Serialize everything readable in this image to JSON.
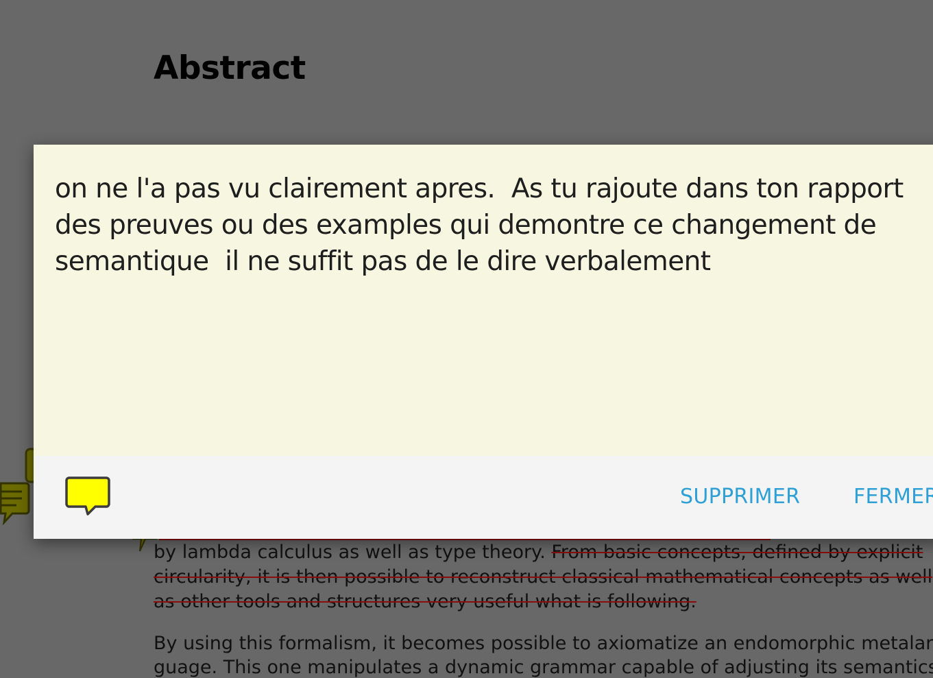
{
  "document": {
    "heading": "Abstract",
    "paragraph1": {
      "line1_start": "by lambda calculus as well as type theory.  ",
      "line1_struck": "From basic concepts, defined by explicit",
      "line2_struck": "circularity, it is then possible to reconstruct classical mathematical concepts as well",
      "line3_struck": "as other tools and structures very useful what is following."
    },
    "paragraph2": {
      "line1": "By using this formalism, it becomes possible to axiomatize an endomorphic metalan-",
      "line2": "guage. This one manipulates a dynamic grammar capable of adjusting its semantics to"
    }
  },
  "comment_dialog": {
    "text": "on ne l'a pas vu clairement apres.  As tu rajoute dans ton rapport des preuves ou des examples qui demontre ce changement de semantique  il ne suffit pas de le dire verbalement",
    "delete_label": "SUPPRIMER",
    "close_label": "FERMER",
    "comment_icon": "speech-bubble-icon"
  },
  "colors": {
    "dim_background": "#686868",
    "note_body": "#f6f6e1",
    "footer": "#f4f4f4",
    "accent": "#2ea0d6",
    "strike": "#8a0d0d",
    "note_icon_fill": "#ffff00"
  }
}
